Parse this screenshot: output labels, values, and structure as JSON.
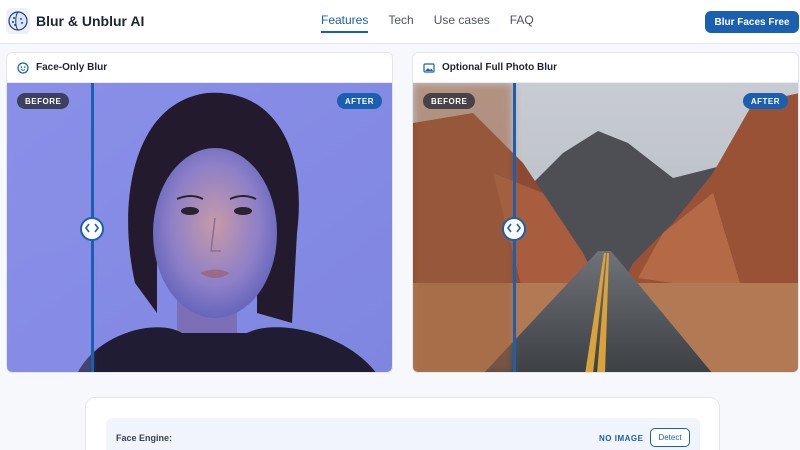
{
  "brand": {
    "name": "Blur & Unblur AI",
    "logo_icon": "face-brain-icon"
  },
  "nav": {
    "items": [
      {
        "label": "Features",
        "active": true
      },
      {
        "label": "Tech",
        "active": false
      },
      {
        "label": "Use cases",
        "active": false
      },
      {
        "label": "FAQ",
        "active": false
      }
    ]
  },
  "cta": {
    "label": "Blur Faces Free"
  },
  "cards": {
    "face": {
      "title": "Face-Only Blur",
      "icon": "face-icon",
      "before_label": "BEFORE",
      "after_label": "AFTER",
      "slider_value": 0.22
    },
    "full": {
      "title": "Optional Full Photo Blur",
      "icon": "image-icon",
      "before_label": "BEFORE",
      "after_label": "AFTER",
      "slider_value": 0.26
    }
  },
  "engine": {
    "label": "Face Engine:",
    "status": "NO IMAGE",
    "detect_label": "Detect"
  },
  "colors": {
    "accent": "#1b5fb0",
    "badge_dark": "#2c303a",
    "background": "#f7f8fb"
  }
}
